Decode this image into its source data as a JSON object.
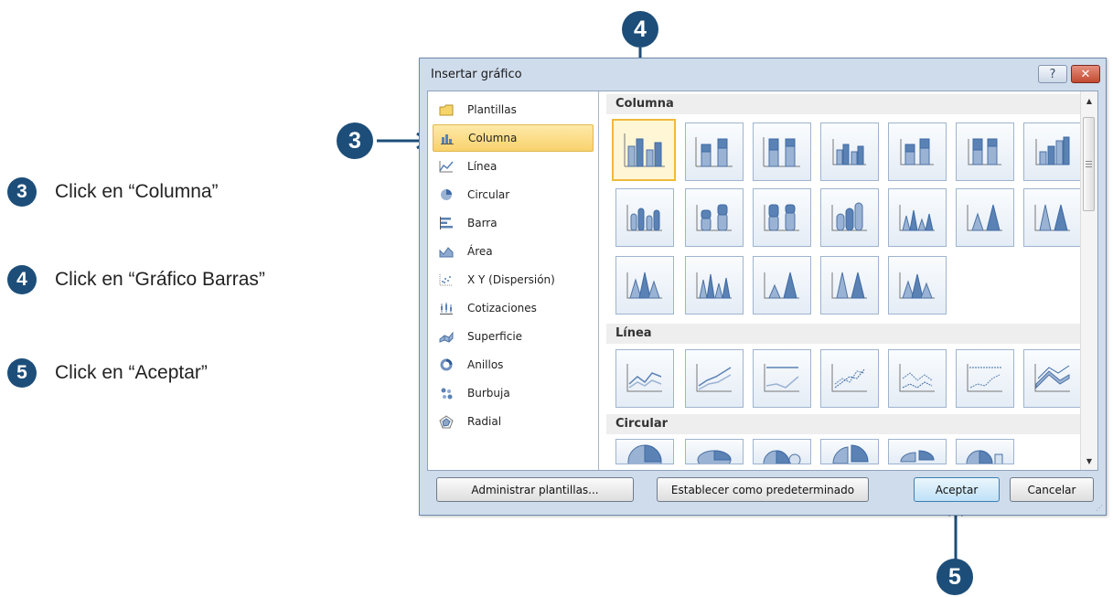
{
  "instructions": [
    {
      "number": "3",
      "text": "Click en “Columna”"
    },
    {
      "number": "4",
      "text": "Click en “Gráfico Barras”"
    },
    {
      "number": "5",
      "text": "Click en “Aceptar”"
    }
  ],
  "callouts": {
    "top": "4",
    "left": "3",
    "bottom": "5"
  },
  "dialog": {
    "title": "Insertar gráfico",
    "help_glyph": "?",
    "close_glyph": "✕",
    "categories": [
      {
        "label": "Plantillas",
        "icon": "folder-icon"
      },
      {
        "label": "Columna",
        "icon": "column-chart-icon",
        "selected": true
      },
      {
        "label": "Línea",
        "icon": "line-chart-icon"
      },
      {
        "label": "Circular",
        "icon": "pie-chart-icon"
      },
      {
        "label": "Barra",
        "icon": "bar-chart-icon"
      },
      {
        "label": "Área",
        "icon": "area-chart-icon"
      },
      {
        "label": "X Y (Dispersión)",
        "icon": "scatter-chart-icon"
      },
      {
        "label": "Cotizaciones",
        "icon": "stock-chart-icon"
      },
      {
        "label": "Superficie",
        "icon": "surface-chart-icon"
      },
      {
        "label": "Anillos",
        "icon": "doughnut-chart-icon"
      },
      {
        "label": "Burbuja",
        "icon": "bubble-chart-icon"
      },
      {
        "label": "Radial",
        "icon": "radar-chart-icon"
      }
    ],
    "sections": [
      {
        "title": "Columna"
      },
      {
        "title": "Línea"
      },
      {
        "title": "Circular"
      }
    ],
    "buttons": {
      "manage_templates": "Administrar plantillas...",
      "set_default": "Establecer como predeterminado",
      "ok": "Aceptar",
      "cancel": "Cancelar"
    }
  },
  "colors": {
    "badge": "#1d4e79",
    "selection_fill": "#f9d26e",
    "selection_border": "#f0b93a",
    "icon_blue": "#5b82b4"
  }
}
